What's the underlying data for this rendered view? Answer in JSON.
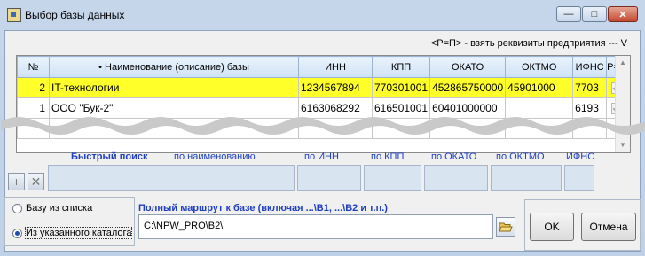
{
  "window": {
    "title": "Выбор базы данных",
    "minimize": "—",
    "maximize": "□",
    "close": "✕"
  },
  "hint": "<Р=П> - взять реквизиты предприятия --- V",
  "grid": {
    "headers": [
      "№",
      "• Наименование (описание) базы",
      "ИНН",
      "КПП",
      "ОКАТО",
      "ОКТМО",
      "ИФНС",
      "Р=П"
    ],
    "rows": [
      {
        "num": "2",
        "name": "IT-технологии",
        "inn": "1234567894",
        "kpp": "770301001",
        "okato": "452865750000",
        "oktmo": "45901000",
        "ifns": "7703",
        "rp": true,
        "selected": true
      },
      {
        "num": "1",
        "name": "ООО \"Бук-2\"",
        "inn": "6163068292",
        "kpp": "616501001",
        "okato": "60401000000",
        "oktmo": "",
        "ifns": "6193",
        "rp": true,
        "selected": false
      }
    ]
  },
  "search": {
    "title": "Быстрый поиск",
    "by_name": "по наименованию",
    "by_inn": "по ИНН",
    "by_kpp": "по КПП",
    "by_okato": "по ОКАТО",
    "by_oktmo": "по ОКТМО",
    "by_ifns": "ИФНС"
  },
  "source": {
    "from_list": "Базу из списка",
    "from_folder": "Из указанного каталога",
    "selected": "from_folder"
  },
  "path": {
    "title": "Полный маршрут к базе (включая ...\\B1, ...\\B2 и т.п.)",
    "value": "C:\\NPW_PRO\\B2\\"
  },
  "buttons": {
    "ok": "OK",
    "cancel": "Отмена",
    "add": "+",
    "remove": "✕"
  },
  "colors": {
    "selected_row": "#ffff29",
    "accent_text": "#1f3fbf"
  }
}
